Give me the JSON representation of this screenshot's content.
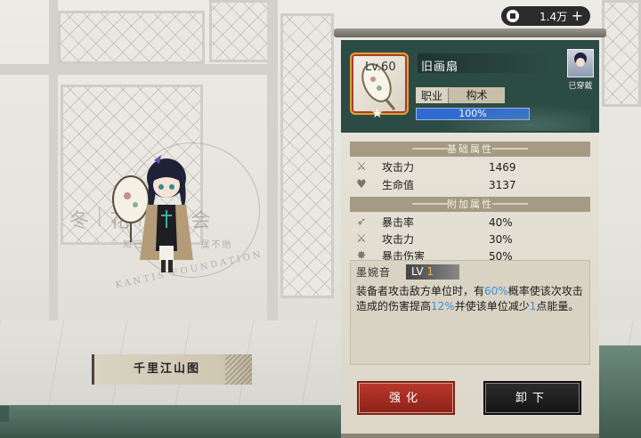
{
  "currency": {
    "amount": "1.4万",
    "add_symbol": "+"
  },
  "equipment": {
    "level": "Lv.60",
    "name": "旧画扇",
    "class_label": "职业",
    "class_value": "构术",
    "progress_percent": 100,
    "progress_text": "100%",
    "equipped_label": "已穿戴"
  },
  "basic_attributes": {
    "title": "基础属性",
    "rows": [
      {
        "icon": "crossed-swords-icon",
        "name": "攻击力",
        "value": "1469"
      },
      {
        "icon": "heart-icon",
        "name": "生命值",
        "value": "3137"
      }
    ]
  },
  "extra_attributes": {
    "title": "附加属性",
    "rows": [
      {
        "icon": "crit-rate-icon",
        "name": "暴击率",
        "value": "40%"
      },
      {
        "icon": "crossed-swords-icon",
        "name": "攻击力",
        "value": "30%"
      },
      {
        "icon": "crit-damage-icon",
        "name": "暴击伤害",
        "value": "50%"
      }
    ]
  },
  "skill": {
    "name": "墨婉音",
    "lv_prefix": "LV",
    "lv_value": "1",
    "desc_parts": [
      "装备者攻击敌方单位时，有",
      "60%",
      "概率使该次攻击造成的伤害提高",
      "12%",
      "并使该单位减少",
      "1",
      "点能量。"
    ]
  },
  "buttons": {
    "strengthen": "强化",
    "unequip": "卸下"
  },
  "scene": {
    "scroll_title": "千里江山图",
    "emblem_chars": [
      "冬",
      "|",
      "花",
      "|",
      "金",
      "|",
      "会"
    ],
    "emblem_sub": "知己 　　 　　 属不贻",
    "emblem_foundation": "KANTIS FOUNDATION"
  },
  "colors": {
    "header": "#2d4b45",
    "highlight": "#3b8fd8",
    "strengthen": "#b9372b"
  }
}
